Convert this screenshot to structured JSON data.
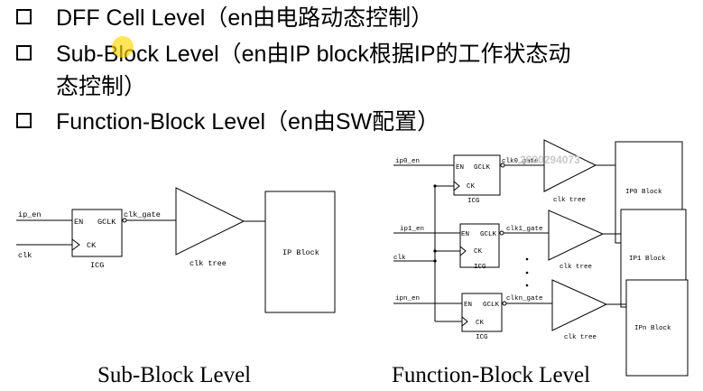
{
  "bullets": [
    {
      "text": "DFF Cell Level（en由电路动态控制）"
    },
    {
      "text": "Sub-Block Level（en由IP block根据IP的工作状态动",
      "continuation": "态控制）"
    },
    {
      "text": "Function-Block Level（en由SW配置）"
    }
  ],
  "sub_block_diagram": {
    "inputs": [
      "ip_en",
      "clk"
    ],
    "icg": {
      "label": "ICG",
      "en_pin": "EN",
      "ck_pin": "CK",
      "out_pin": "GCLK"
    },
    "out_net": "clk_gate",
    "tree_label": "clk tree",
    "block_label": "IP Block",
    "caption": "Sub-Block Level"
  },
  "function_block_diagram": {
    "rows": [
      {
        "input": "ip0_en",
        "out_net": "clk0_gate",
        "block": "IP0 Block"
      },
      {
        "input": "ip1_en",
        "out_net": "clk1_gate",
        "block": "IP1 Block"
      },
      {
        "input": "ipn_en",
        "out_net": "clkn_gate",
        "block": "IPn Block"
      }
    ],
    "clk_input": "clk",
    "icg": {
      "label": "ICG",
      "en_pin": "EN",
      "ck_pin": "CK",
      "out_pin": "GCLK"
    },
    "tree_label": "clk tree",
    "caption": "Function-Block Level"
  },
  "watermark": "2600294073"
}
